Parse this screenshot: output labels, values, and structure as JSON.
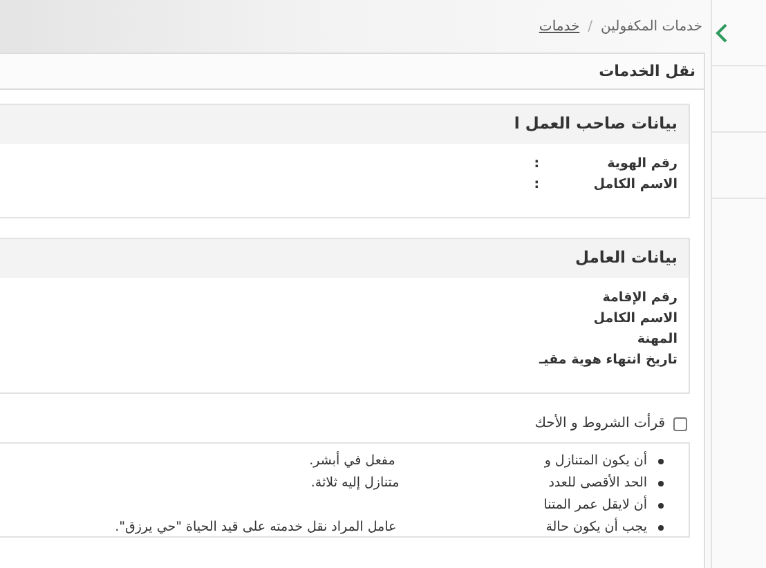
{
  "breadcrumb": [
    {
      "label": "خدمات المكفولين",
      "link": false
    },
    {
      "label": "خدمات",
      "link": true
    }
  ],
  "breadcrumb_separator": "/",
  "card": {
    "title": "نقل الخدمات"
  },
  "sections": [
    {
      "title": "بيانات صاحب العمل ا",
      "rows": [
        {
          "label": "رقم الهوية",
          "colon": ":"
        },
        {
          "label": "الاسم الكامل",
          "colon": ":"
        }
      ]
    },
    {
      "title": "بيانات العامل",
      "rows": [
        {
          "label": "رقم الإقامة"
        },
        {
          "label": "الاسم الكامل"
        },
        {
          "label": "المهنة"
        },
        {
          "label": "تاريخ انتهاء هوية مقيـ"
        }
      ]
    }
  ],
  "terms_checkbox": {
    "label": "قرأت الشروط و الأحك",
    "checked": false
  },
  "terms": [
    {
      "start": "أن يكون المتنازل و",
      "end": "مفعل في أبشر."
    },
    {
      "start": "الحد الأقصى للعدد",
      "end": "متنازل إليه ثلاثة."
    },
    {
      "start": "أن لايقل عمر المتنا"
    },
    {
      "start": "يجب أن يكون حالة",
      "end": "عامل المراد نقل خدمته على قيد الحياة \"حي يرزق\"."
    }
  ]
}
